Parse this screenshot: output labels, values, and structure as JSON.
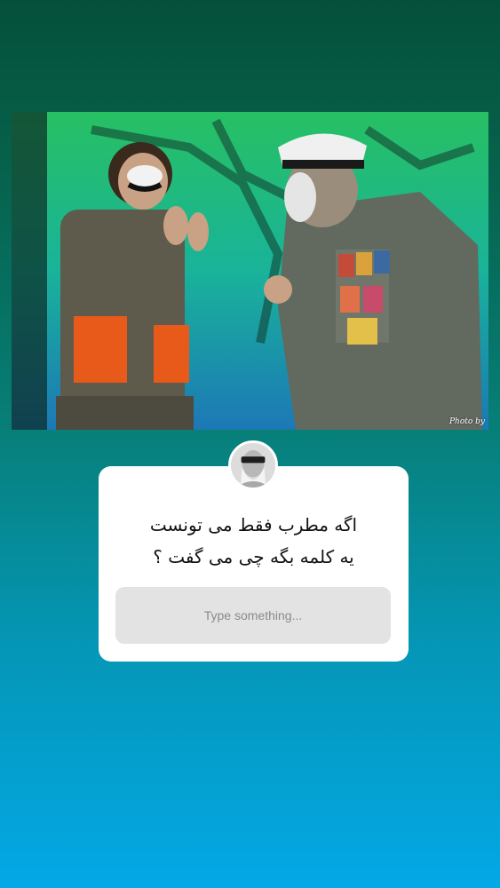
{
  "story": {
    "photo": {
      "credit": "Photo by"
    }
  },
  "question_sticker": {
    "question_line_1": "اگه مطرب  فقط می تونست",
    "question_line_2": "یه کلمه بگه چی می گفت ؟",
    "answer_placeholder": "Type something..."
  },
  "colors": {
    "background_top": "#05503a",
    "background_bottom": "#03a8e6",
    "card": "#ffffff",
    "input": "#e3e3e3"
  }
}
